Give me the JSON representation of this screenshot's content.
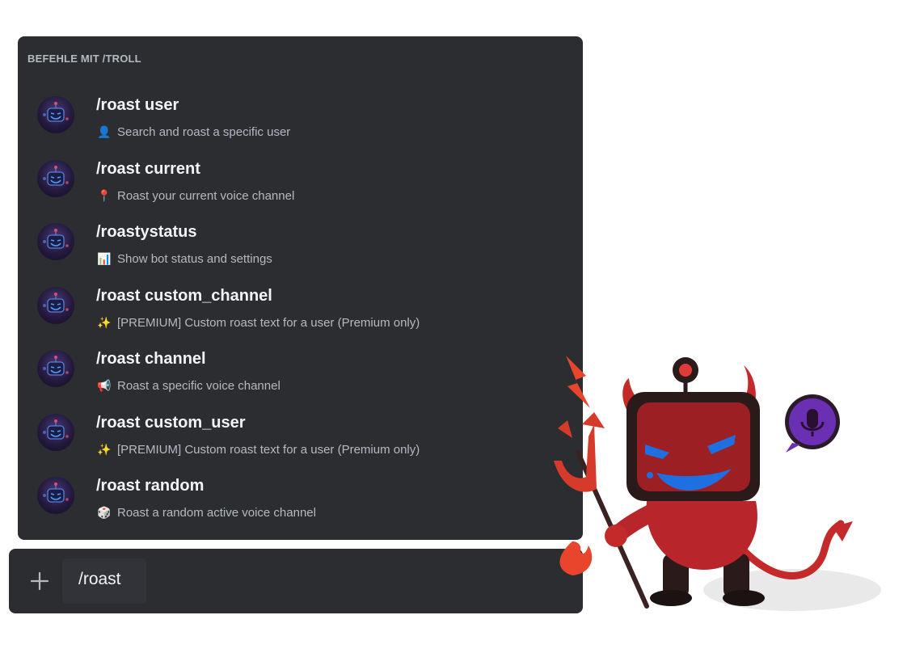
{
  "popup": {
    "header": "BEFEHLE MIT /TROLL",
    "commands": [
      {
        "name": "/roast user",
        "emoji": "👤",
        "description": "Search and roast a specific user"
      },
      {
        "name": "/roast current",
        "emoji": "📍",
        "description": "Roast your current voice channel"
      },
      {
        "name": "/roastystatus",
        "emoji": "📊",
        "description": "Show bot status and settings"
      },
      {
        "name": "/roast custom_channel",
        "emoji": "✨",
        "description": "[PREMIUM] Custom roast text for a user (Premium only)"
      },
      {
        "name": "/roast channel",
        "emoji": "📢",
        "description": "Roast a specific voice channel"
      },
      {
        "name": "/roast custom_user",
        "emoji": "✨",
        "description": "[PREMIUM] Custom roast text for a user (Premium only)"
      },
      {
        "name": "/roast random",
        "emoji": "🎲",
        "description": "Roast a random active voice channel"
      }
    ]
  },
  "input": {
    "value": "/roast"
  },
  "colors": {
    "panel": "#2b2d31",
    "text_primary": "#f2f3f5",
    "text_muted": "#b5bac1",
    "devil_red": "#c42a2a",
    "face_blue": "#1e6fe0",
    "mic_purple": "#6b2fb3"
  }
}
